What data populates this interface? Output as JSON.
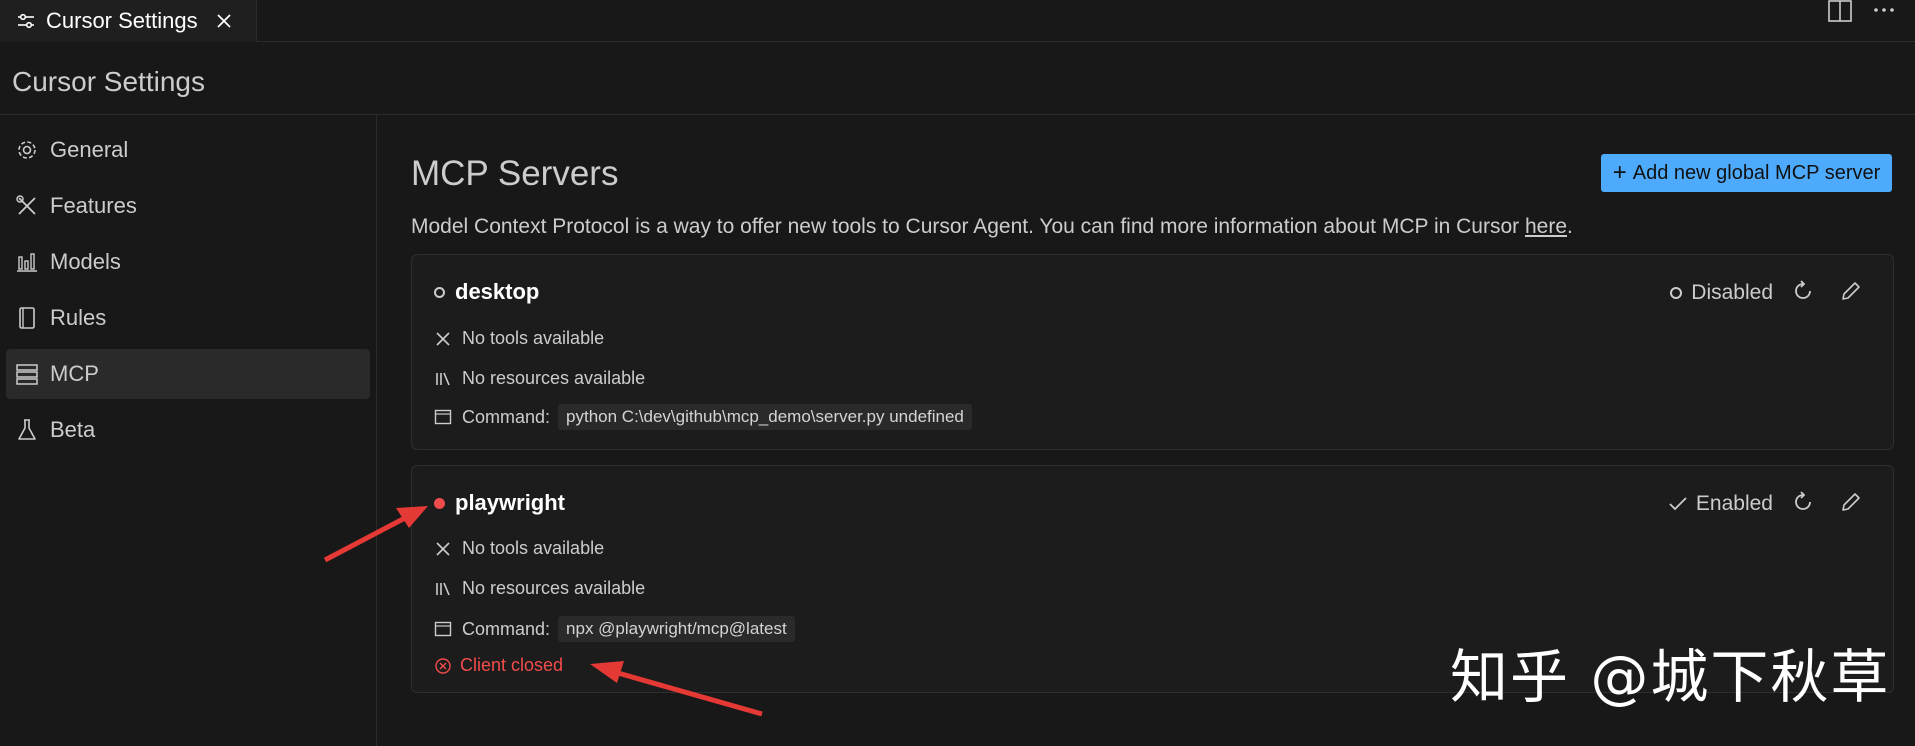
{
  "tab": {
    "title": "Cursor Settings",
    "icon": "settings-sliders-icon",
    "close_icon": "close-icon"
  },
  "window_actions": {
    "split_icon": "split-editor-icon",
    "more_icon": "more-icon"
  },
  "page": {
    "header": "Cursor Settings"
  },
  "sidebar": {
    "items": [
      {
        "label": "General",
        "icon": "gear-icon",
        "active": false
      },
      {
        "label": "Features",
        "icon": "tools-icon",
        "active": false
      },
      {
        "label": "Models",
        "icon": "chart-icon",
        "active": false
      },
      {
        "label": "Rules",
        "icon": "book-icon",
        "active": false
      },
      {
        "label": "MCP",
        "icon": "server-icon",
        "active": true
      },
      {
        "label": "Beta",
        "icon": "flask-icon",
        "active": false
      }
    ]
  },
  "main": {
    "title": "MCP Servers",
    "add_button": "Add new global MCP server",
    "description_text": "Model Context Protocol is a way to offer new tools to Cursor Agent. You can find more information about MCP in Cursor ",
    "description_link": "here",
    "description_end": "."
  },
  "servers": [
    {
      "name": "desktop",
      "status": "Disabled",
      "dot_color": "#cccccc",
      "tools": "No tools available",
      "resources": "No resources available",
      "command_label": "Command:",
      "command": "python C:\\dev\\github\\mcp_demo\\server.py undefined"
    },
    {
      "name": "playwright",
      "status": "Enabled",
      "dot_color": "#f14c4c",
      "tools": "No tools available",
      "resources": "No resources available",
      "command_label": "Command:",
      "command": "npx @playwright/mcp@latest",
      "error": "Client closed"
    }
  ],
  "watermark": "知乎 @城下秋草",
  "colors": {
    "accent": "#4daafc",
    "error": "#f14c4c",
    "background": "#181818"
  }
}
